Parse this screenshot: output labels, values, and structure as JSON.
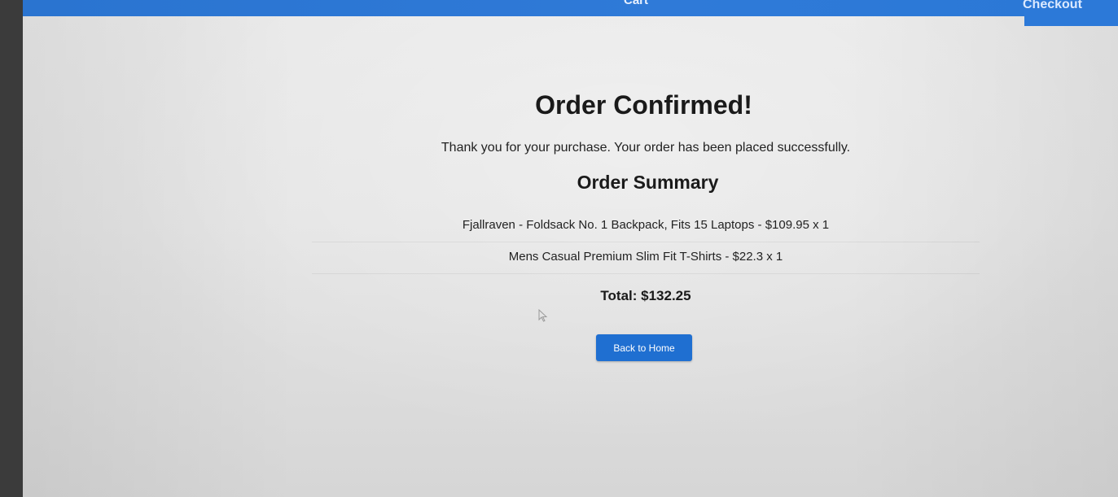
{
  "navbar": {
    "cart_label": "Cart",
    "checkout_label": "Checkout",
    "color": "#2f7ad8"
  },
  "confirmation": {
    "title": "Order Confirmed!",
    "message": "Thank you for your purchase. Your order has been placed successfully."
  },
  "summary": {
    "title": "Order Summary",
    "items": [
      {
        "text": "Fjallraven - Foldsack No. 1 Backpack, Fits 15 Laptops - $109.95 x 1"
      },
      {
        "text": "Mens Casual Premium Slim Fit T-Shirts - $22.3 x 1"
      }
    ],
    "total_label": "Total: $132.25"
  },
  "actions": {
    "back_home_label": "Back to Home",
    "button_color": "#1f6fd1"
  },
  "icons": {
    "cursor": "mouse-pointer-icon"
  }
}
